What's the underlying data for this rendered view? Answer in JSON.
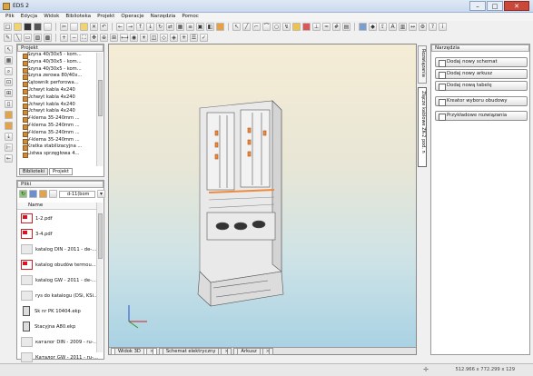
{
  "window": {
    "title": "EDS 2",
    "minimize": "–",
    "maximize": "□",
    "close": "✕"
  },
  "menu": [
    "Plik",
    "Edycja",
    "Widok",
    "Biblioteka",
    "Projekt",
    "Operacje",
    "Narzędzia",
    "Pomoc"
  ],
  "project_panel": {
    "title": "Projekt",
    "items": [
      "Szyna 40/30x5 - kom...",
      "Szyna 40/30x5 - kom...",
      "Szyna 40/30x5 - kom...",
      "Szyna zerowa 80/40x...",
      "Kątownik perforowa...",
      "Uchwyt kabla 4x240",
      "Uchwyt kabla 4x240",
      "Uchwyt kabla 4x240",
      "Uchwyt kabla 4x240",
      "V-klema 35-240mm ...",
      "V-klema 35-240mm ...",
      "V-klema 35-240mm ...",
      "V-klema 35-240mm ...",
      "Kratka stabilizacyjna ...",
      "Listwa sprzęgłowa 4..."
    ],
    "tabs": [
      "Biblioteki",
      "Projekt"
    ]
  },
  "files_panel": {
    "title": "Pliki",
    "path": "d-11(bom",
    "column_header": "Name",
    "files": [
      {
        "name": "1-2.pdf",
        "type": "pdf"
      },
      {
        "name": "3-4.pdf",
        "type": "pdf"
      },
      {
        "name": "katalog DIN - 2011 - de-...",
        "type": "catalog"
      },
      {
        "name": "katalog obudów termou...",
        "type": "catalog"
      },
      {
        "name": "katalog GW - 2011 - de-...",
        "type": "catalog"
      },
      {
        "name": "rys do katalogu (DSi, KSi...",
        "type": "catalog"
      },
      {
        "name": "Sk nr PK 10404.ekp",
        "type": "ekp"
      },
      {
        "name": "Stacyjna A80.ekp",
        "type": "ekp"
      },
      {
        "name": "каталог DIN - 2009 - ru-...",
        "type": "catalog"
      },
      {
        "name": "Каталог GW - 2011 - ru-...",
        "type": "catalog"
      }
    ]
  },
  "canvas_tabs": [
    "Widok 3D",
    "Schemat elektryczny",
    "Arkusz"
  ],
  "side_tabs": [
    "Rozwiązania",
    "Złącze kablowe ZK-2 pod. n"
  ],
  "tools_panel": {
    "title": "Narzędzia",
    "buttons": [
      "Dodaj nowy schemat",
      "Dodaj nowy arkusz",
      "Dodaj nową tabelę",
      "Kreator wyboru obudowy",
      "Przykładowe rozwiązania"
    ]
  },
  "status": {
    "coords": "512.966 x 772.299 x 129"
  },
  "toolbar_row1_icons": [
    "new-icon",
    "open-icon",
    "save-icon",
    "save-all-icon",
    "print-icon",
    "cut-icon",
    "copy-icon",
    "paste-icon",
    "undo-icon",
    "redo-icon"
  ],
  "toolbar_row2_icons": [
    "pencil-icon",
    "line-icon",
    "rect-icon",
    "text-icon",
    "zoom-icon"
  ]
}
